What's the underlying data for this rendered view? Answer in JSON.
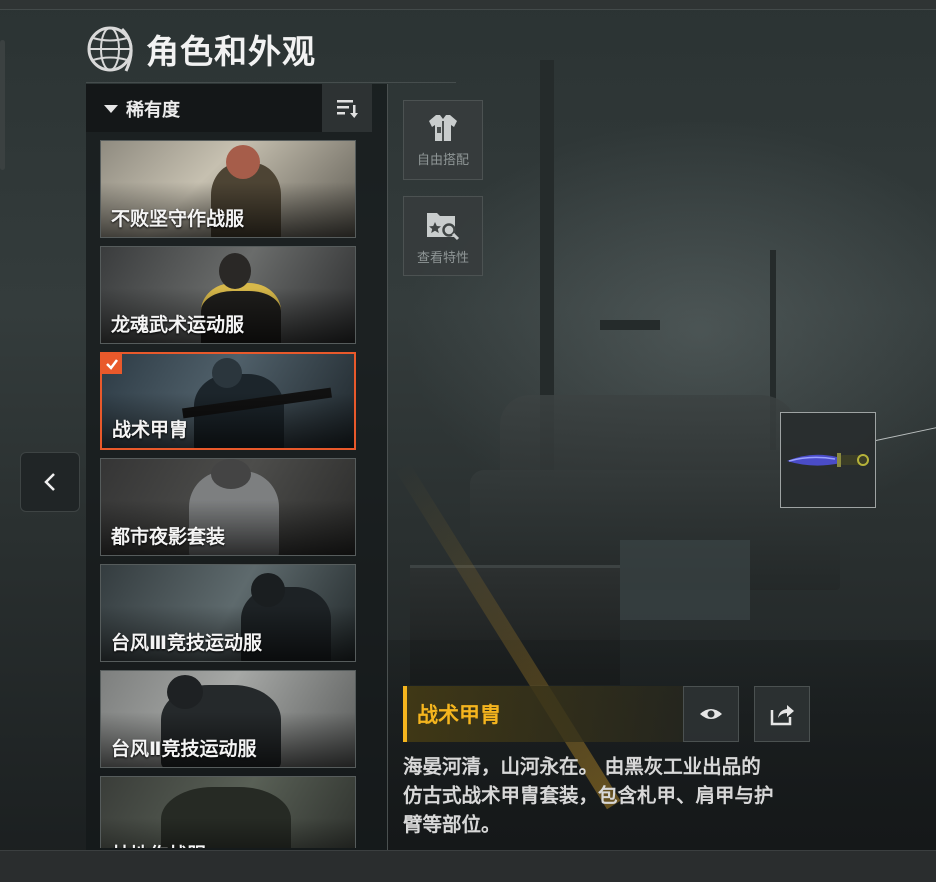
{
  "header": {
    "title": "角色和外观",
    "icon": "globe-icon"
  },
  "sort": {
    "label": "稀有度",
    "order_icon": "sort-order-icon"
  },
  "outfits": [
    {
      "label": "不败坚守作战服",
      "selected": false
    },
    {
      "label": "龙魂武术运动服",
      "selected": false
    },
    {
      "label": "战术甲胄",
      "selected": true
    },
    {
      "label": "都市夜影套装",
      "selected": false
    },
    {
      "label": "台风Ⅲ竞技运动服",
      "selected": false
    },
    {
      "label": "台风Ⅱ竞技运动服",
      "selected": false
    },
    {
      "label": "林地作战服",
      "selected": false
    }
  ],
  "tools": [
    {
      "label": "自由搭配",
      "icon": "outfit-mix-icon"
    },
    {
      "label": "查看特性",
      "icon": "view-traits-icon"
    }
  ],
  "navigation": {
    "prev_icon": "chevron-left-icon"
  },
  "weapon_slot": {
    "icon": "knife-icon"
  },
  "detail": {
    "name": "战术甲胄",
    "preview_icon": "eye-icon",
    "share_icon": "share-icon",
    "description_lines": [
      "海晏河清，山河永在。 由黑灰工业出品的",
      "仿古式战术甲胄套装，包含札甲、肩甲与护",
      "臂等部位。"
    ]
  },
  "colors": {
    "accent": "#e9592b",
    "highlight": "#f5b51e"
  }
}
